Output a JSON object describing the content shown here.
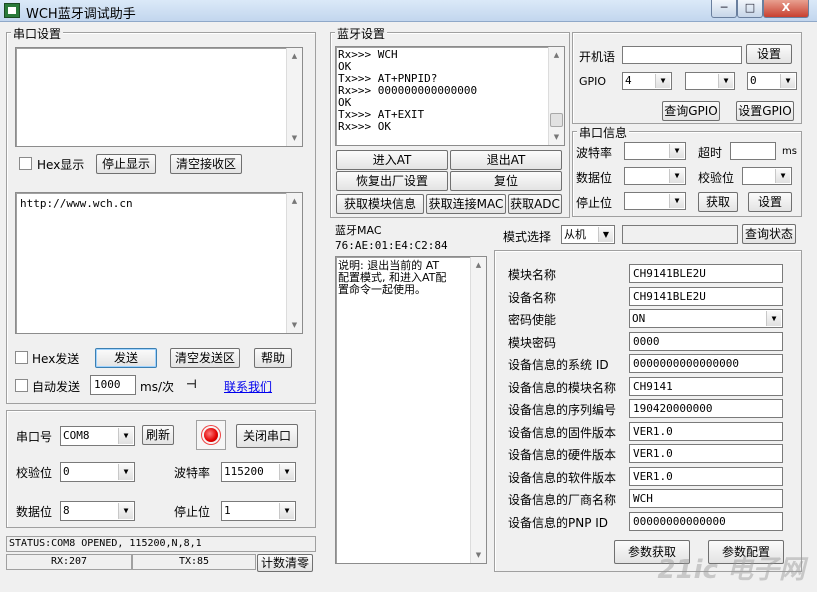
{
  "window": {
    "title": "WCH蓝牙调试助手",
    "min": "─",
    "max": "□",
    "close": "X"
  },
  "serial_group": {
    "title": "串口设置",
    "hex_display": "Hex显示",
    "stop_display": "停止显示",
    "clear_receive": "清空接收区",
    "send_text": "http://www.wch.cn",
    "hex_send": "Hex发送",
    "send": "发送",
    "clear_send": "清空发送区",
    "help": "帮助",
    "auto_send": "自动发送",
    "interval_value": "1000",
    "interval_unit": "ms/次",
    "contact": "联系我们",
    "port_label": "串口号",
    "port_value": "COM8",
    "refresh": "刷新",
    "close_port": "关闭串口",
    "parity_label": "校验位",
    "parity_value": "0",
    "baud_label": "波特率",
    "baud_value": "115200",
    "databits_label": "数据位",
    "databits_value": "8",
    "stopbits_label": "停止位",
    "stopbits_value": "1"
  },
  "status": {
    "line": "STATUS:COM8 OPENED, 115200,N,8,1",
    "rx": "RX:207",
    "tx": "TX:85",
    "clear_count": "计数清零"
  },
  "bt_group": {
    "title": "蓝牙设置",
    "log": [
      "Rx>>> WCH",
      "OK",
      "Tx>>> AT+PNPID?",
      "Rx>>> 000000000000000",
      "OK",
      "Tx>>> AT+EXIT",
      "Rx>>> OK"
    ],
    "enter_at": "进入AT",
    "exit_at": "退出AT",
    "factory_reset": "恢复出厂设置",
    "reset": "复位",
    "get_module_info": "获取模块信息",
    "get_conn_mac": "获取连接MAC",
    "get_adc": "获取ADC",
    "mac_label": "蓝牙MAC",
    "mac_value": "76:AE:01:E4:C2:84",
    "desc": [
      "说明: 退出当前的 AT",
      "配置模式, 和进入AT配",
      "置命令一起使用。"
    ]
  },
  "boot": {
    "label": "开机语",
    "value": "",
    "set": "设置",
    "gpio_label": "GPIO",
    "gpio1": "4",
    "gpio2": "",
    "gpio3": "0",
    "query_gpio": "查询GPIO",
    "set_gpio": "设置GPIO"
  },
  "uart_info": {
    "title": "串口信息",
    "baud_label": "波特率",
    "timeout_label": "超时",
    "timeout_unit": "ms",
    "data_label": "数据位",
    "parity_label": "校验位",
    "stop_label": "停止位",
    "get": "获取",
    "set": "设置"
  },
  "mode": {
    "label": "模式选择",
    "value": "从机",
    "status_value": "",
    "query": "查询状态"
  },
  "params": [
    {
      "label": "模块名称",
      "value": "CH9141BLE2U"
    },
    {
      "label": "设备名称",
      "value": "CH9141BLE2U"
    },
    {
      "label": "密码使能",
      "value": "ON"
    },
    {
      "label": "模块密码",
      "value": "0000"
    },
    {
      "label": "设备信息的系统 ID",
      "value": "0000000000000000"
    },
    {
      "label": "设备信息的模块名称",
      "value": "CH9141"
    },
    {
      "label": "设备信息的序列编号",
      "value": "190420000000"
    },
    {
      "label": "设备信息的固件版本",
      "value": "VER1.0"
    },
    {
      "label": "设备信息的硬件版本",
      "value": "VER1.0"
    },
    {
      "label": "设备信息的软件版本",
      "value": "VER1.0"
    },
    {
      "label": "设备信息的厂商名称",
      "value": "WCH"
    },
    {
      "label": "设备信息的PNP ID",
      "value": "00000000000000"
    }
  ],
  "param_buttons": {
    "get": "参数获取",
    "set": "参数配置"
  },
  "watermark": "21ic 电子网"
}
